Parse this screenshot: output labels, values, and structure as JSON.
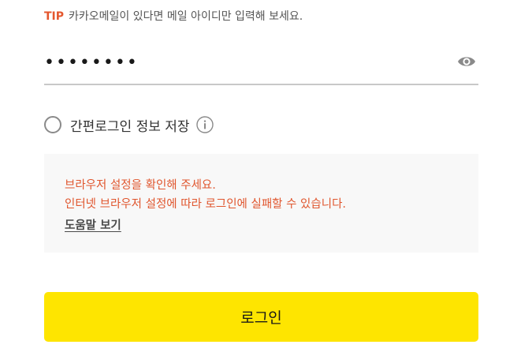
{
  "tip": {
    "label": "TIP",
    "text": "카카오메일이 있다면 메일 아이디만 입력해 보세요."
  },
  "password": {
    "value": "••••••••",
    "toggle_icon": "eye-icon"
  },
  "save_login": {
    "label": "간편로그인 정보 저장",
    "checked": false,
    "info_icon": "info-icon"
  },
  "notice": {
    "line1": "브라우저 설정을 확인해 주세요.",
    "line2": "인터넷 브라우저 설정에 따라 로그인에 실패할 수 있습니다.",
    "help_link": "도움말 보기"
  },
  "login_button": {
    "label": "로그인"
  },
  "colors": {
    "accent_yellow": "#fee500",
    "tip_orange": "#e4572e",
    "notice_red": "#e0562e",
    "notice_bg": "#f8f8f8"
  }
}
